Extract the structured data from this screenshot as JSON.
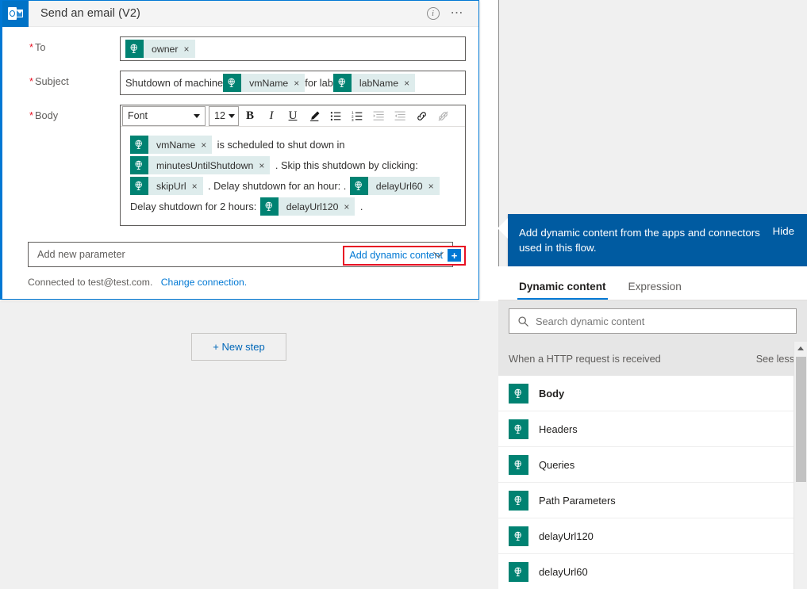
{
  "card": {
    "app_icon": "outlook-icon",
    "title": "Send an email (V2)",
    "info_icon": "info-icon",
    "more_icon": "ellipsis-icon",
    "fields": {
      "to": {
        "label": "To",
        "required_marker": "*",
        "tokens": [
          {
            "label": "owner",
            "remove": "×"
          }
        ]
      },
      "subject": {
        "label": "Subject",
        "required_marker": "*",
        "parts": [
          {
            "type": "text",
            "value": "Shutdown of machine"
          },
          {
            "type": "token",
            "label": "vmName",
            "remove": "×"
          },
          {
            "type": "text",
            "value": "for lab"
          },
          {
            "type": "token",
            "label": "labName",
            "remove": "×"
          }
        ]
      },
      "body": {
        "label": "Body",
        "required_marker": "*",
        "toolbar": {
          "font_name": "Font",
          "font_size": "12",
          "bold": "B",
          "italic": "I",
          "underline": "U",
          "highlight_icon": "pen-highlight-icon",
          "bulleted_list_icon": "bulleted-list-icon",
          "numbered_list_icon": "numbered-list-icon",
          "indent_icon": "indent-increase-icon",
          "outdent_icon": "indent-decrease-icon",
          "link_icon": "link-icon",
          "unlink_icon": "unlink-icon"
        },
        "parts": [
          {
            "type": "token",
            "label": "vmName",
            "remove": "×"
          },
          {
            "type": "text",
            "value": "is scheduled to shut down in"
          },
          {
            "type": "token",
            "label": "minutesUntilShutdown",
            "remove": "×"
          },
          {
            "type": "text",
            "value": ". Skip this shutdown by clicking:"
          },
          {
            "type": "token",
            "label": "skipUrl",
            "remove": "×"
          },
          {
            "type": "text",
            "value": ". Delay shutdown for an hour: ."
          },
          {
            "type": "token",
            "label": "delayUrl60",
            "remove": "×"
          },
          {
            "type": "text",
            "value": "Delay shutdown for 2 hours:"
          },
          {
            "type": "token",
            "label": "delayUrl120",
            "remove": "×"
          },
          {
            "type": "text",
            "value": "."
          }
        ]
      }
    },
    "add_dynamic_content": {
      "label": "Add dynamic content",
      "plus": "+",
      "highlight_color": "#e81123"
    },
    "add_new_parameter": "Add new parameter",
    "connection": {
      "text": "Connected to test@test.com.",
      "change_link": "Change connection."
    }
  },
  "canvas": {
    "new_step_button": "+ New step"
  },
  "panel": {
    "callout": {
      "text": "Add dynamic content from the apps and connectors used in this flow.",
      "hide_label": "Hide",
      "background": "#005ba1"
    },
    "tabs": [
      {
        "label": "Dynamic content",
        "active": true
      },
      {
        "label": "Expression",
        "active": false
      }
    ],
    "search": {
      "placeholder": "Search dynamic content",
      "value": "",
      "icon": "search-icon"
    },
    "group": {
      "title": "When a HTTP request is received",
      "toggle_label": "See less"
    },
    "items": [
      {
        "label": "Body",
        "icon": "dynamic-token-icon"
      },
      {
        "label": "Headers",
        "icon": "dynamic-token-icon"
      },
      {
        "label": "Queries",
        "icon": "dynamic-token-icon"
      },
      {
        "label": "Path Parameters",
        "icon": "dynamic-token-icon"
      },
      {
        "label": "delayUrl120",
        "icon": "dynamic-token-icon"
      },
      {
        "label": "delayUrl60",
        "icon": "dynamic-token-icon"
      }
    ],
    "scrollbar": {
      "up_icon": "scroll-up-arrow-icon"
    }
  },
  "colors": {
    "accent_blue": "#0078d4",
    "banner_blue": "#005ba1",
    "token_teal": "#008272",
    "token_label_bg": "#deecec",
    "required_red": "#e81123"
  }
}
